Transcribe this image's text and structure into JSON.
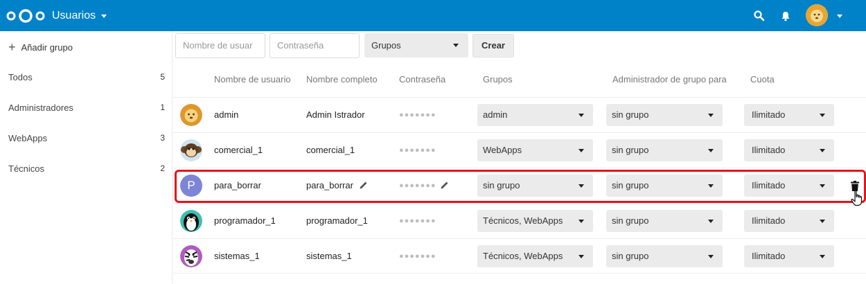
{
  "header": {
    "app_title": "Usuarios",
    "icons": [
      "nextcloud-logo",
      "search-icon",
      "bell-icon",
      "user-avatar"
    ],
    "color": "#0082c9"
  },
  "sidebar": {
    "add_group": "Añadir grupo",
    "items": [
      {
        "label": "Todos",
        "count": "5"
      },
      {
        "label": "Administradores",
        "count": "1"
      },
      {
        "label": "WebApps",
        "count": "3"
      },
      {
        "label": "Técnicos",
        "count": "2"
      }
    ]
  },
  "create_form": {
    "username_placeholder": "Nombre de usuar",
    "password_placeholder": "Contraseña",
    "groups_label": "Grupos",
    "create_label": "Crear"
  },
  "table": {
    "headers": {
      "username": "Nombre de usuario",
      "fullname": "Nombre completo",
      "password": "Contraseña",
      "groups": "Grupos",
      "subadmin": "Administrador de grupo para",
      "quota": "Cuota"
    },
    "rows": [
      {
        "avatar": "lion",
        "username": "admin",
        "fullname": "Admin Istrador",
        "password": "●●●●●●●",
        "groups": "admin",
        "subadmin": "sin grupo",
        "quota": "Ilimitado"
      },
      {
        "avatar": "monkey",
        "username": "comercial_1",
        "fullname": "comercial_1",
        "password": "●●●●●●●",
        "groups": "WebApps",
        "subadmin": "sin grupo",
        "quota": "Ilimitado"
      },
      {
        "avatar": "letter-P",
        "avatar_letter": "P",
        "username": "para_borrar",
        "fullname": "para_borrar",
        "password": "●●●●●●●",
        "groups": "sin grupo",
        "subadmin": "sin grupo",
        "quota": "Ilimitado",
        "highlighted": true
      },
      {
        "avatar": "penguin",
        "username": "programador_1",
        "fullname": "programador_1",
        "password": "●●●●●●●",
        "groups": "Técnicos, WebApps",
        "subadmin": "sin grupo",
        "quota": "Ilimitado"
      },
      {
        "avatar": "zebra",
        "username": "sistemas_1",
        "fullname": "sistemas_1",
        "password": "●●●●●●●",
        "groups": "Técnicos, WebApps",
        "subadmin": "sin grupo",
        "quota": "Ilimitado"
      }
    ]
  },
  "colors": {
    "accent": "#0082c9",
    "highlight_border": "#e8121a",
    "avatar_letter_bg": "#7e85d6"
  }
}
